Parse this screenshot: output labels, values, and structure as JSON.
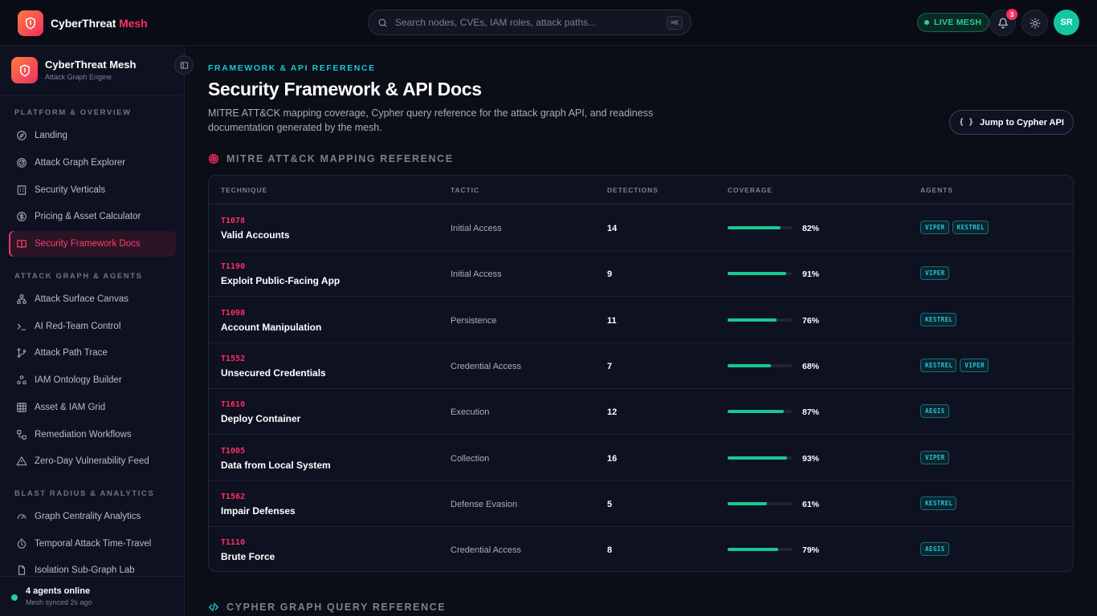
{
  "topbar": {
    "brand_main": "CyberThreat",
    "brand_accent": "Mesh",
    "search_placeholder": "Search nodes, CVEs, IAM roles, attack paths...",
    "search_shortcut": "⌘K",
    "live_label": "LIVE MESH",
    "notification_count": "3",
    "avatar_initials": "SR"
  },
  "sidebar": {
    "title": "CyberThreat Mesh",
    "subtitle": "Attack Graph Engine",
    "sections": [
      {
        "label": "PLATFORM & OVERVIEW",
        "items": [
          {
            "label": "Landing",
            "icon": "compass-icon"
          },
          {
            "label": "Attack Graph Explorer",
            "icon": "radar-icon"
          },
          {
            "label": "Security Verticals",
            "icon": "building-icon"
          },
          {
            "label": "Pricing & Asset Calculator",
            "icon": "dollar-icon"
          },
          {
            "label": "Security Framework Docs",
            "icon": "book-icon",
            "active": true
          }
        ]
      },
      {
        "label": "ATTACK GRAPH & AGENTS",
        "items": [
          {
            "label": "Attack Surface Canvas",
            "icon": "network-icon"
          },
          {
            "label": "AI Red-Team Control",
            "icon": "terminal-icon"
          },
          {
            "label": "Attack Path Trace",
            "icon": "git-branch-icon"
          },
          {
            "label": "IAM Ontology Builder",
            "icon": "boxes-icon"
          },
          {
            "label": "Asset & IAM Grid",
            "icon": "grid-icon"
          },
          {
            "label": "Remediation Workflows",
            "icon": "workflow-icon"
          },
          {
            "label": "Zero-Day Vulnerability Feed",
            "icon": "warning-icon"
          }
        ]
      },
      {
        "label": "BLAST RADIUS & ANALYTICS",
        "items": [
          {
            "label": "Graph Centrality Analytics",
            "icon": "gauge-icon"
          },
          {
            "label": "Temporal Attack Time-Travel",
            "icon": "timer-icon"
          },
          {
            "label": "Isolation Sub-Graph Lab",
            "icon": "file-icon"
          }
        ]
      }
    ],
    "footer": {
      "status": "4 agents online",
      "sync": "Mesh synced 2s ago"
    }
  },
  "main": {
    "eyebrow": "FRAMEWORK & API REFERENCE",
    "title": "Security Framework & API Docs",
    "description": "MITRE ATT&CK mapping coverage, Cypher query reference for the attack graph API, and readiness documentation generated by the mesh.",
    "jump_button": "Jump to Cypher API",
    "jump_icon": "{ }",
    "mitre_section_title": "MITRE ATT&CK MAPPING REFERENCE",
    "cypher_section_title": "CYPHER GRAPH QUERY REFERENCE",
    "table": {
      "headers": [
        "TECHNIQUE",
        "TACTIC",
        "DETECTIONS",
        "COVERAGE",
        "AGENTS"
      ],
      "rows": [
        {
          "id": "T1078",
          "name": "Valid Accounts",
          "tactic": "Initial Access",
          "detections": "14",
          "coverage": 82,
          "coverage_label": "82%",
          "agents": [
            "VIPER",
            "KESTREL"
          ]
        },
        {
          "id": "T1190",
          "name": "Exploit Public-Facing App",
          "tactic": "Initial Access",
          "detections": "9",
          "coverage": 91,
          "coverage_label": "91%",
          "agents": [
            "VIPER"
          ]
        },
        {
          "id": "T1098",
          "name": "Account Manipulation",
          "tactic": "Persistence",
          "detections": "11",
          "coverage": 76,
          "coverage_label": "76%",
          "agents": [
            "KESTREL"
          ]
        },
        {
          "id": "T1552",
          "name": "Unsecured Credentials",
          "tactic": "Credential Access",
          "detections": "7",
          "coverage": 68,
          "coverage_label": "68%",
          "agents": [
            "KESTREL",
            "VIPER"
          ]
        },
        {
          "id": "T1610",
          "name": "Deploy Container",
          "tactic": "Execution",
          "detections": "12",
          "coverage": 87,
          "coverage_label": "87%",
          "agents": [
            "AEGIS"
          ]
        },
        {
          "id": "T1005",
          "name": "Data from Local System",
          "tactic": "Collection",
          "detections": "16",
          "coverage": 93,
          "coverage_label": "93%",
          "agents": [
            "VIPER"
          ]
        },
        {
          "id": "T1562",
          "name": "Impair Defenses",
          "tactic": "Defense Evasion",
          "detections": "5",
          "coverage": 61,
          "coverage_label": "61%",
          "agents": [
            "KESTREL"
          ]
        },
        {
          "id": "T1110",
          "name": "Brute Force",
          "tactic": "Credential Access",
          "detections": "8",
          "coverage": 79,
          "coverage_label": "79%",
          "agents": [
            "AEGIS"
          ]
        }
      ]
    }
  },
  "colors": {
    "accent_pink": "#ff2f66",
    "accent_cyan": "#16c9d7",
    "success_green": "#22d39a",
    "background": "#0b0d17"
  }
}
